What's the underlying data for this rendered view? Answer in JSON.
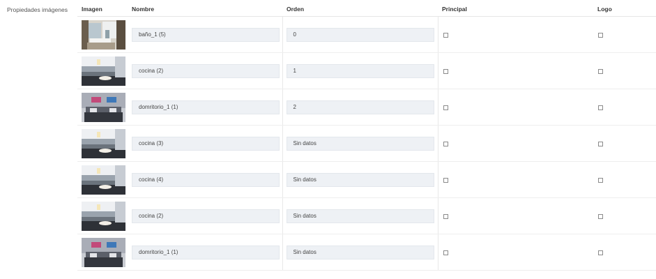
{
  "section_label": "Propiedades imágenes",
  "columns": {
    "imagen": "Imagen",
    "nombre": "Nombre",
    "orden": "Orden",
    "principal": "Principal",
    "logo": "Logo"
  },
  "rows": [
    {
      "thumb": "bathroom-photo",
      "nombre": "baño_1 (5)",
      "orden": "0",
      "principal": false,
      "logo": false
    },
    {
      "thumb": "kitchen-photo",
      "nombre": "cocina (2)",
      "orden": "1",
      "principal": false,
      "logo": false
    },
    {
      "thumb": "bedroom-photo",
      "nombre": "domritorio_1 (1)",
      "orden": "2",
      "principal": false,
      "logo": false
    },
    {
      "thumb": "kitchen-photo",
      "nombre": "cocina (3)",
      "orden": "Sin datos",
      "principal": false,
      "logo": false
    },
    {
      "thumb": "kitchen-photo",
      "nombre": "cocina (4)",
      "orden": "Sin datos",
      "principal": false,
      "logo": false
    },
    {
      "thumb": "kitchen-photo",
      "nombre": "cocina (2)",
      "orden": "Sin datos",
      "principal": false,
      "logo": false
    },
    {
      "thumb": "bedroom-photo",
      "nombre": "domritorio_1 (1)",
      "orden": "Sin datos",
      "principal": false,
      "logo": false
    }
  ]
}
